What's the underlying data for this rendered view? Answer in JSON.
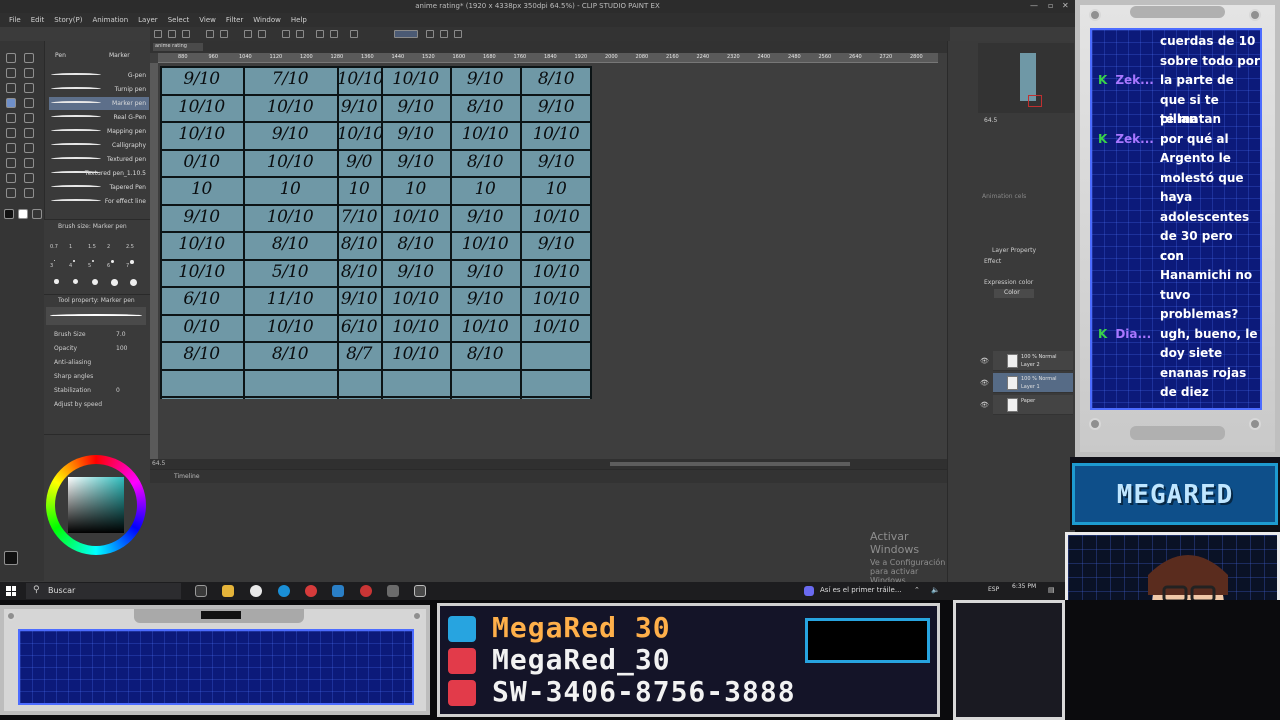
{
  "app": {
    "title": "anime rating* (1920 x 4338px 350dpi 64.5%) - CLIP STUDIO PAINT EX",
    "menu": [
      "File",
      "Edit",
      "Story(P)",
      "Animation",
      "Layer",
      "Select",
      "View",
      "Filter",
      "Window",
      "Help"
    ],
    "subtool_tabs": [
      "Pen",
      "Marker"
    ],
    "brushes": [
      "G-pen",
      "Turnip pen",
      "Marker pen",
      "Real G-Pen",
      "Mapping pen",
      "Calligraphy",
      "Textured pen",
      "Textured pen_1.10.5",
      "Tapered Pen",
      "For effect line"
    ],
    "brush_size_title": "Brush size: Marker pen",
    "brush_sizes": [
      "0.7",
      "1",
      "1.5",
      "2",
      "2.5",
      "3",
      "4",
      "5",
      "6",
      "7"
    ],
    "tool_property_title": "Tool property: Marker pen",
    "tool_property_name": "Marker pen",
    "properties": [
      {
        "label": "Brush Size",
        "value": "7.0"
      },
      {
        "label": "Opacity",
        "value": "100"
      },
      {
        "label": "Anti-aliasing",
        "value": ""
      },
      {
        "label": "Sharp angles",
        "value": ""
      },
      {
        "label": "Stabilization",
        "value": "0"
      },
      {
        "label": "Adjust by speed",
        "value": ""
      }
    ],
    "ruler_ticks": [
      "880",
      "960",
      "1040",
      "1120",
      "1200",
      "1280",
      "1360",
      "1440",
      "1520",
      "1600",
      "1680",
      "1760",
      "1840",
      "1920",
      "2000",
      "2080",
      "2160",
      "2240",
      "2320",
      "2400",
      "2480",
      "2560",
      "2640",
      "2720",
      "2800"
    ],
    "zoom": "64.5",
    "timeline_title": "Timeline",
    "layer_property_title": "Layer Property",
    "effect_label": "Effect",
    "expression_color_label": "Expression color",
    "color_label": "Color",
    "layers": [
      {
        "name": "100 % Normal\nLayer 2"
      },
      {
        "name": "100 % Normal\nLayer 1"
      },
      {
        "name": "Paper"
      }
    ],
    "animation_cels_label": "Animation cels",
    "activate_windows": {
      "line1": "Activar Windows",
      "line2": "Ve a Configuración para activar Windows."
    }
  },
  "table": {
    "rows": [
      [
        "9/10",
        "7/10",
        "10/10",
        "10/10",
        "9/10",
        "8/10"
      ],
      [
        "10/10",
        "10/10",
        "9/10",
        "9/10",
        "8/10",
        "9/10"
      ],
      [
        "10/10",
        "9/10",
        "10/10",
        "9/10",
        "10/10",
        "10/10"
      ],
      [
        "0/10",
        "10/10",
        "9/0",
        "9/10",
        "8/10",
        "9/10"
      ],
      [
        "10",
        "10",
        "10",
        "10",
        "10",
        "10"
      ],
      [
        "9/10",
        "10/10",
        "7/10",
        "10/10",
        "9/10",
        "10/10"
      ],
      [
        "10/10",
        "8/10",
        "8/10",
        "8/10",
        "10/10",
        "9/10"
      ],
      [
        "10/10",
        "5/10",
        "8/10",
        "9/10",
        "9/10",
        "10/10"
      ],
      [
        "6/10",
        "11/10",
        "9/10",
        "10/10",
        "9/10",
        "10/10"
      ],
      [
        "0/10",
        "10/10",
        "6/10",
        "10/10",
        "10/10",
        "10/10"
      ],
      [
        "8/10",
        "8/10",
        "8/7",
        "10/10",
        "8/10",
        ""
      ],
      [
        "",
        "",
        "",
        "",
        "",
        ""
      ]
    ]
  },
  "taskbar": {
    "search_placeholder": "Buscar",
    "news": "Así es el primer tráile...",
    "lang": "ESP",
    "time": "6:35 PM"
  },
  "chat": {
    "lines": [
      {
        "user": "",
        "text": "cuerdas de 10"
      },
      {
        "user": "",
        "text": "sobre todo por"
      },
      {
        "user": "Zek...",
        "text": "la parte de"
      },
      {
        "user": "",
        "text": "que si te pillan"
      },
      {
        "user": "",
        "text": "te matan"
      },
      {
        "user": "Zek...",
        "text": "por qué al"
      },
      {
        "user": "",
        "text": "Argento le"
      },
      {
        "user": "",
        "text": "molestó que"
      },
      {
        "user": "",
        "text": "haya"
      },
      {
        "user": "",
        "text": "adolescentes"
      },
      {
        "user": "",
        "text": "de 30 pero con"
      },
      {
        "user": "",
        "text": "con"
      },
      {
        "user": "",
        "text": "Hanamichi no"
      },
      {
        "user": "",
        "text": "tuvo"
      },
      {
        "user": "",
        "text": "problemas?"
      },
      {
        "user": "Dia...",
        "text": "ugh, bueno, le"
      },
      {
        "user": "",
        "text": "doy siete"
      },
      {
        "user": "",
        "text": "enanas rojas"
      },
      {
        "user": "",
        "text": "de diez"
      }
    ],
    "user_prefix": "K"
  },
  "brand": {
    "logo": "MEGARED"
  },
  "socials": [
    {
      "icon": "twitter-icon",
      "handle": "MegaRed 30",
      "color": "#ffb04a"
    },
    {
      "icon": "youtube-icon",
      "handle": "MegaRed_30",
      "color": "#f2f2f2"
    },
    {
      "icon": "nintendo-switch-icon",
      "handle": "SW-3406-8756-3888",
      "color": "#f2f2f2"
    }
  ],
  "colors": {
    "sheet": "#6f98a6",
    "chat_bg": "#0c1a7a",
    "accent": "#27a4e0",
    "chat_user": "#a877ff",
    "chat_k": "#39d24b"
  }
}
